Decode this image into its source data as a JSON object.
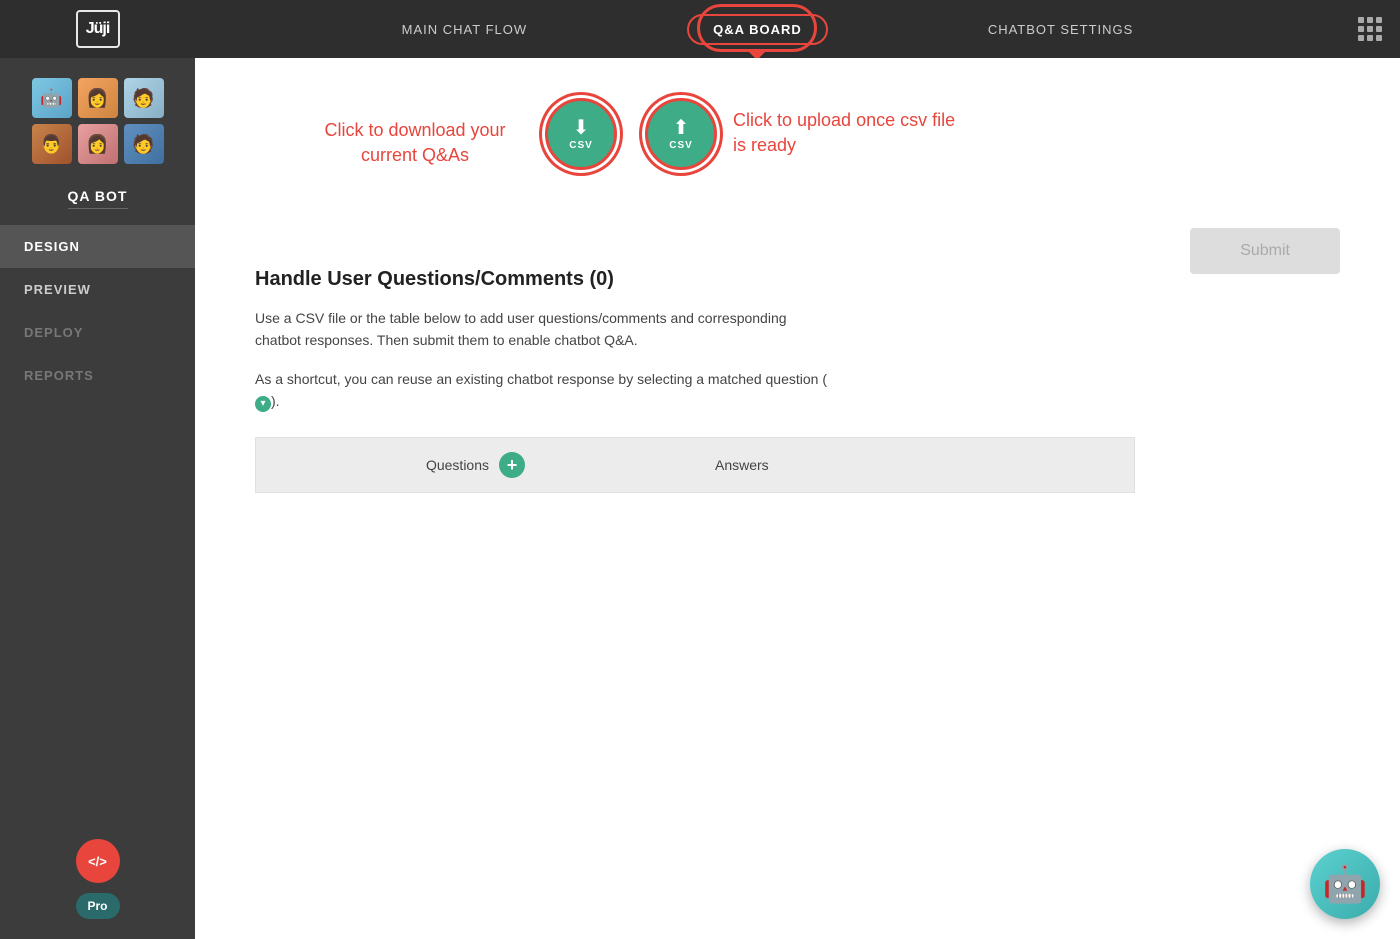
{
  "nav": {
    "logo_text": "Jüji",
    "links": [
      {
        "id": "main-chat-flow",
        "label": "MAIN CHAT FLOW",
        "active": false
      },
      {
        "id": "qa-board",
        "label": "Q&A BOARD",
        "active": true
      },
      {
        "id": "chatbot-settings",
        "label": "CHATBOT SETTINGS",
        "active": false
      }
    ]
  },
  "sidebar": {
    "bot_name": "QA BOT",
    "menu_items": [
      {
        "id": "design",
        "label": "DESIGN",
        "active": true
      },
      {
        "id": "preview",
        "label": "PREVIEW",
        "active": false
      },
      {
        "id": "deploy",
        "label": "DEPLOY",
        "active": false,
        "disabled": true
      },
      {
        "id": "reports",
        "label": "REPORTS",
        "active": false,
        "disabled": true
      }
    ],
    "code_label": "</>",
    "pro_label": "Pro"
  },
  "content": {
    "annotation_left": "Click to download your current Q&As",
    "annotation_right": "Click to upload once csv file is ready",
    "download_csv_label": "CSV",
    "upload_csv_label": "CSV",
    "qa_title": "Handle User Questions/Comments (0)",
    "description_1": "Use a CSV file or the table below to add user questions/comments and corresponding chatbot responses. Then submit them to enable chatbot Q&A.",
    "description_2": "As a shortcut, you can reuse an existing chatbot response by selecting a matched question (",
    "description_2_end": ").",
    "submit_label": "Submit",
    "table": {
      "col_questions": "Questions",
      "col_answers": "Answers"
    }
  }
}
